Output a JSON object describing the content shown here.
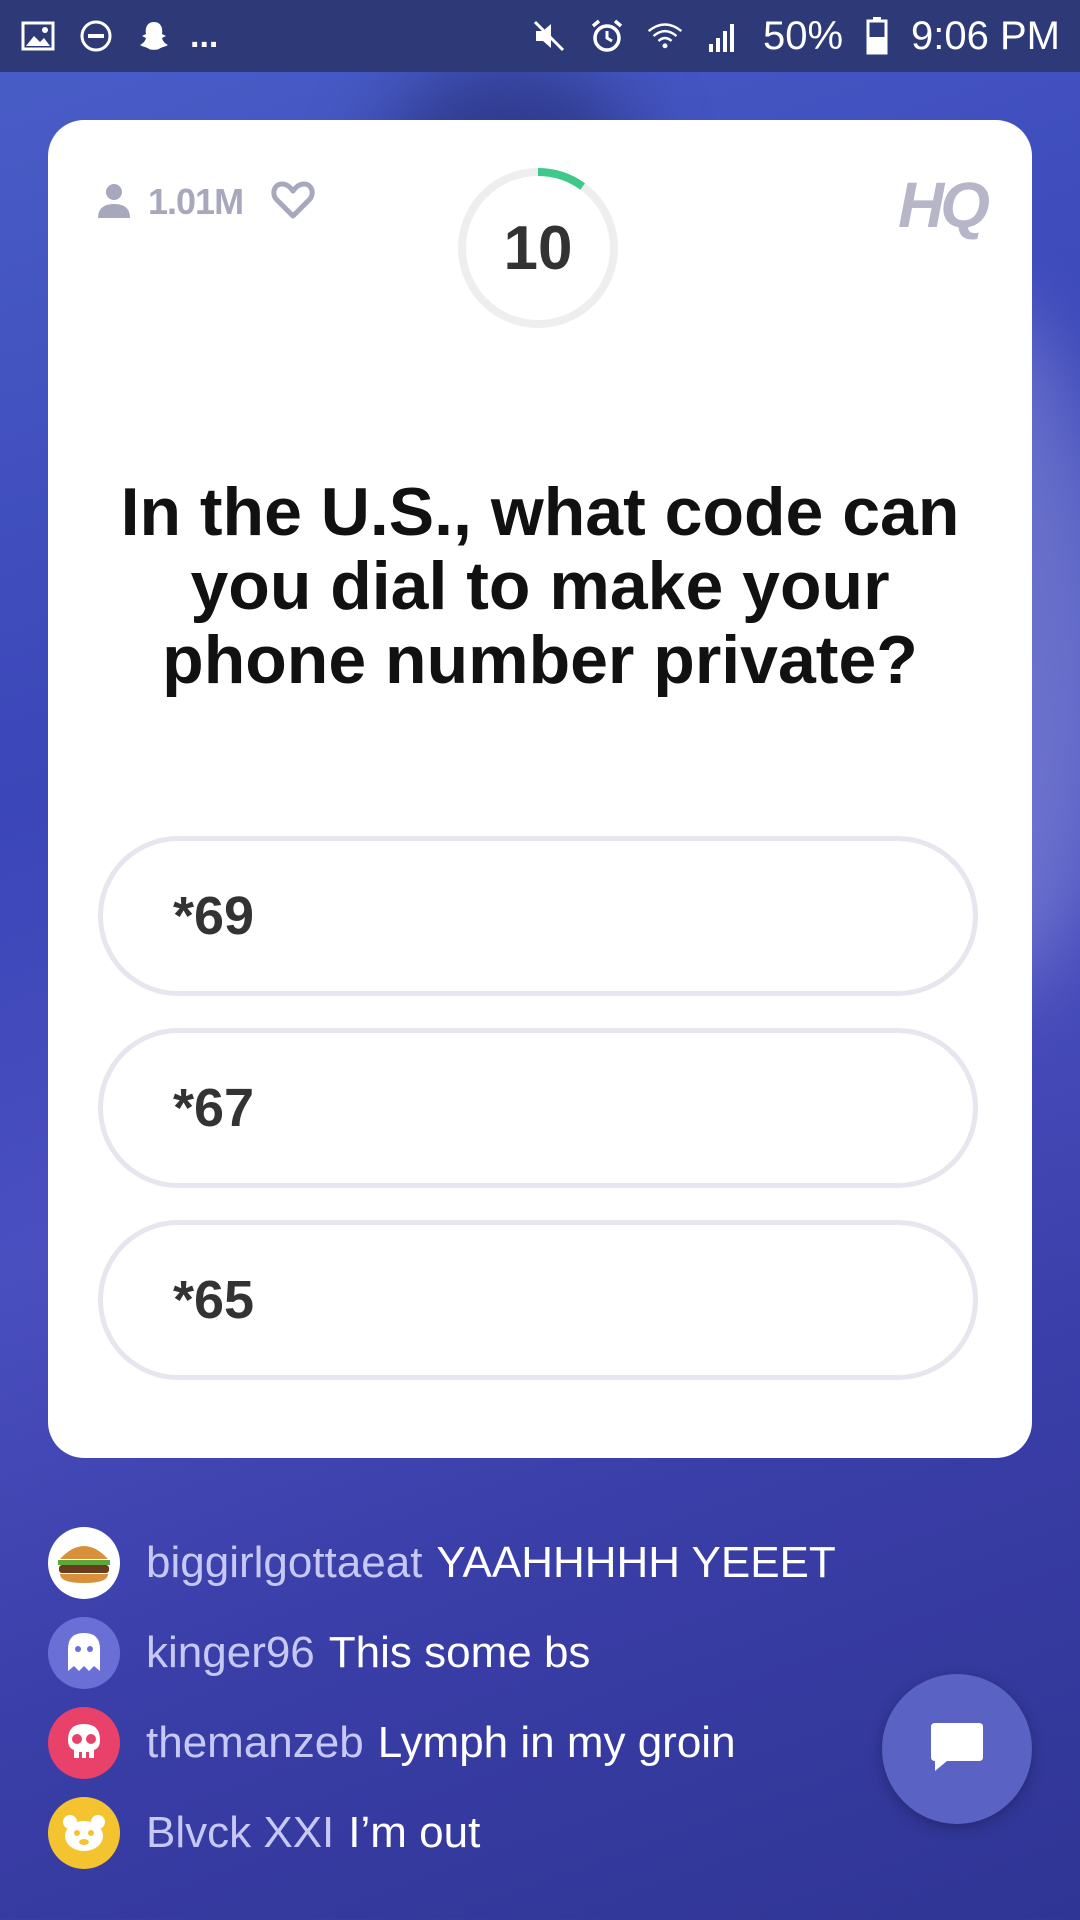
{
  "status_bar": {
    "left_icons": [
      "image-icon",
      "do-not-disturb-icon",
      "snapchat-icon",
      "more-dots-icon"
    ],
    "more_text": "...",
    "right_icons": [
      "mute-icon",
      "alarm-icon",
      "wifi-icon",
      "signal-icon",
      "battery-icon"
    ],
    "battery": "50%",
    "time": "9:06 PM"
  },
  "game": {
    "viewer_count": "1.01M",
    "timer": "10",
    "timer_progress": 0.1,
    "logo": "HQ",
    "question": "In the U.S., what code can you dial to make your phone number private?",
    "answers": [
      "*69",
      "*67",
      "*65"
    ]
  },
  "chat": [
    {
      "user": "biggirlgottaeat",
      "message": "YAAHHHHH YEEET",
      "avatar": "burger-icon",
      "avatar_color": "#ffffff"
    },
    {
      "user": "kinger96",
      "message": "This some bs",
      "avatar": "ghost-icon",
      "avatar_color": "#6a6fd6"
    },
    {
      "user": "themanzeb",
      "message": "Lymph in my groin",
      "avatar": "skull-icon",
      "avatar_color": "#e8416a"
    },
    {
      "user": "Blvck XXI",
      "message": "I’m out",
      "avatar": "bear-icon",
      "avatar_color": "#f4c430"
    }
  ],
  "colors": {
    "background": "#3b46b8",
    "accent_timer": "#3ec98a",
    "answer_border": "#e6e6ee",
    "chat_username": "#c6c8f5"
  }
}
